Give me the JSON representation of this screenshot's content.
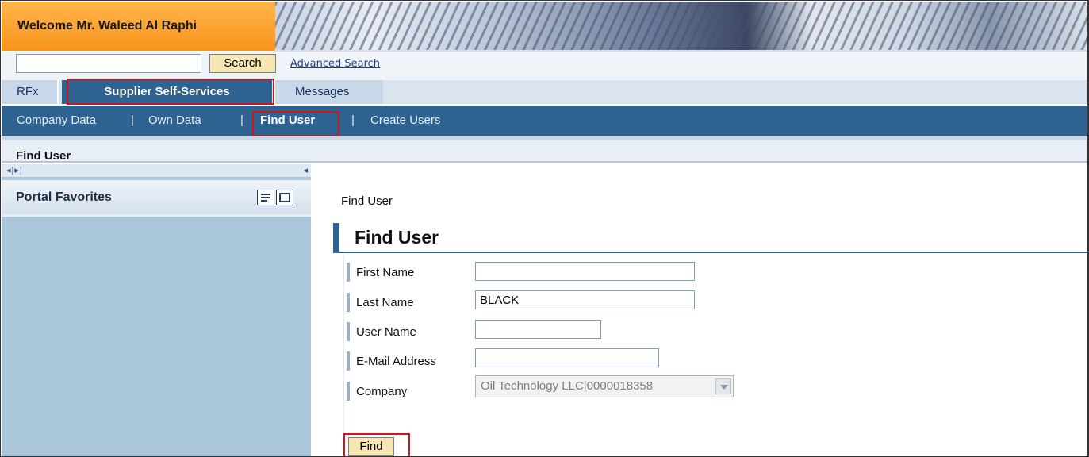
{
  "header": {
    "welcome": "Welcome Mr. Waleed Al Raphi"
  },
  "search": {
    "value": "",
    "button": "Search",
    "advanced_link": "Advanced Search"
  },
  "top_tabs": [
    "RFx",
    "Supplier Self-Services",
    "Messages"
  ],
  "sub_nav": {
    "items": [
      "Company Data",
      "Own Data",
      "Find User",
      "Create Users"
    ],
    "separator": "|",
    "active": "Find User"
  },
  "page_title": "Find User",
  "sidebar": {
    "handle": "◂|▸|",
    "collapse": "◂",
    "favorites_title": "Portal Favorites"
  },
  "content": {
    "breadcrumb": "Find User",
    "section_title": "Find User",
    "fields": {
      "first_name": {
        "label": "First Name",
        "value": ""
      },
      "last_name": {
        "label": "Last Name",
        "value": "BLACK"
      },
      "user_name": {
        "label": "User Name",
        "value": ""
      },
      "email": {
        "label": "E-Mail Address",
        "value": ""
      },
      "company": {
        "label": "Company",
        "value": "Oil Technology LLC|0000018358"
      }
    },
    "find_button": "Find"
  },
  "colors": {
    "accent_orange": "#f7941d",
    "nav_blue": "#2e6291",
    "sidebar_blue": "#a9c6db",
    "button_yellow": "#f6e7b5",
    "highlight_red": "#d0141a"
  }
}
